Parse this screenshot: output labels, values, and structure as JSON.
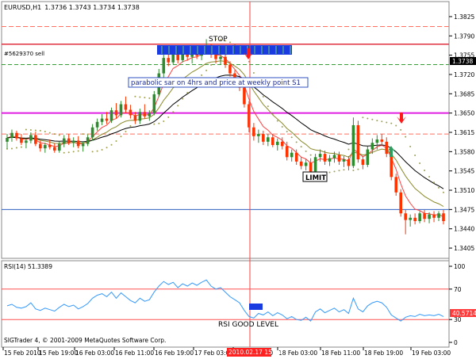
{
  "header": {
    "symbol": "EURUSD,H1",
    "ohlc": "1.3736 1.3743 1.3734 1.3738"
  },
  "price_axis": {
    "ticks": [
      "1.3825",
      "1.3790",
      "1.3755",
      "1.3720",
      "1.3685",
      "1.3650",
      "1.3615",
      "1.3580",
      "1.3545",
      "1.3510",
      "1.3475",
      "1.3440",
      "1.3405"
    ],
    "current_price": "1.3738"
  },
  "annotations": {
    "order_label": "#5629370 sell",
    "stop_label": "STOP",
    "sar_note": "parabolic sar on 4hrs and price at weekly point S1",
    "limit_label": "LIMIT",
    "rsi_good_level": "RSI GOOD LEVEL"
  },
  "rsi": {
    "title": "RSI(14) 51.3389",
    "ticks": [
      "100",
      "70",
      "30",
      "0"
    ],
    "current_value": "40.5714"
  },
  "time_axis": {
    "labels": [
      "15 Feb 2010",
      "15 Feb 19:00",
      "16 Feb 03:00",
      "16 Feb 11:00",
      "16 Feb 19:00",
      "17 Feb 03:00",
      "17 Feb 11:00",
      "18 Feb 03:00",
      "18 Feb 11:00",
      "18 Feb 19:00",
      "19 Feb 03:00"
    ],
    "cursor_label": "2010.02.17 15:00"
  },
  "copyright": "SIGTrader 4, © 2001-2009 MetaQuotes Software Corp.",
  "colors": {
    "bull": "#2e8b2e",
    "bear": "#ff3300",
    "magenta_level": "#e020e0",
    "stop_line": "#e03040",
    "blue_level": "#3060c0",
    "cursor": "#ff4040",
    "rsi_line": "#3399ff",
    "sar_dots": "#a0a050"
  },
  "icons": {
    "sell_arrow": "red-down-arrow-icon",
    "buy_arrow": "green-up-arrow-icon"
  },
  "chart_data": {
    "type": "candlestick",
    "instrument": "EURUSD",
    "timeframe": "H1",
    "ylim": [
      1.3395,
      1.3835
    ],
    "candles": [
      [
        1.3598,
        1.3612,
        1.3585,
        1.3605
      ],
      [
        1.3605,
        1.362,
        1.3598,
        1.3614
      ],
      [
        1.3614,
        1.3618,
        1.36,
        1.3604
      ],
      [
        1.3604,
        1.3612,
        1.3592,
        1.3596
      ],
      [
        1.3596,
        1.3604,
        1.3586,
        1.36
      ],
      [
        1.36,
        1.3615,
        1.3595,
        1.361
      ],
      [
        1.361,
        1.3616,
        1.359,
        1.3594
      ],
      [
        1.3594,
        1.36,
        1.358,
        1.3586
      ],
      [
        1.3586,
        1.3596,
        1.3578,
        1.3592
      ],
      [
        1.3592,
        1.3602,
        1.3584,
        1.3588
      ],
      [
        1.3588,
        1.3595,
        1.3578,
        1.3582
      ],
      [
        1.3582,
        1.3598,
        1.3578,
        1.3594
      ],
      [
        1.3594,
        1.361,
        1.3588,
        1.3604
      ],
      [
        1.3604,
        1.3612,
        1.3592,
        1.3596
      ],
      [
        1.3596,
        1.3606,
        1.3588,
        1.36
      ],
      [
        1.36,
        1.3608,
        1.3586,
        1.359
      ],
      [
        1.359,
        1.3598,
        1.358,
        1.3594
      ],
      [
        1.3594,
        1.361,
        1.359,
        1.3606
      ],
      [
        1.3606,
        1.363,
        1.36,
        1.3624
      ],
      [
        1.3624,
        1.364,
        1.3618,
        1.3634
      ],
      [
        1.3634,
        1.3648,
        1.3628,
        1.364
      ],
      [
        1.364,
        1.3652,
        1.363,
        1.3636
      ],
      [
        1.3636,
        1.366,
        1.3632,
        1.3655
      ],
      [
        1.3655,
        1.3668,
        1.364,
        1.3646
      ],
      [
        1.3646,
        1.3672,
        1.3642,
        1.3666
      ],
      [
        1.3666,
        1.368,
        1.365,
        1.3656
      ],
      [
        1.3656,
        1.3665,
        1.364,
        1.3646
      ],
      [
        1.3646,
        1.3652,
        1.363,
        1.3636
      ],
      [
        1.3636,
        1.3658,
        1.363,
        1.3652
      ],
      [
        1.3652,
        1.3666,
        1.364,
        1.3644
      ],
      [
        1.3644,
        1.3655,
        1.3636,
        1.365
      ],
      [
        1.365,
        1.369,
        1.3646,
        1.3684
      ],
      [
        1.3684,
        1.373,
        1.368,
        1.3722
      ],
      [
        1.3722,
        1.3758,
        1.3712,
        1.375
      ],
      [
        1.375,
        1.3762,
        1.3735,
        1.3742
      ],
      [
        1.3742,
        1.3765,
        1.3738,
        1.376
      ],
      [
        1.376,
        1.3768,
        1.374,
        1.3746
      ],
      [
        1.3746,
        1.3764,
        1.3742,
        1.3758
      ],
      [
        1.3758,
        1.377,
        1.3745,
        1.3752
      ],
      [
        1.3752,
        1.3764,
        1.374,
        1.376
      ],
      [
        1.376,
        1.3772,
        1.3748,
        1.3754
      ],
      [
        1.3754,
        1.377,
        1.3746,
        1.3766
      ],
      [
        1.3766,
        1.3784,
        1.376,
        1.377
      ],
      [
        1.377,
        1.3776,
        1.375,
        1.3756
      ],
      [
        1.3756,
        1.3764,
        1.374,
        1.3748
      ],
      [
        1.3748,
        1.3758,
        1.3738,
        1.3752
      ],
      [
        1.3752,
        1.3758,
        1.3732,
        1.3738
      ],
      [
        1.3738,
        1.3744,
        1.3716,
        1.3722
      ],
      [
        1.3722,
        1.3728,
        1.37,
        1.3708
      ],
      [
        1.3708,
        1.3716,
        1.369,
        1.3696
      ],
      [
        1.3696,
        1.3702,
        1.366,
        1.3666
      ],
      [
        1.3666,
        1.3672,
        1.3615,
        1.3624
      ],
      [
        1.3624,
        1.3632,
        1.36,
        1.3608
      ],
      [
        1.3608,
        1.362,
        1.3596,
        1.3612
      ],
      [
        1.3612,
        1.3618,
        1.3592,
        1.3598
      ],
      [
        1.3598,
        1.3612,
        1.359,
        1.3606
      ],
      [
        1.3606,
        1.3612,
        1.3588,
        1.3592
      ],
      [
        1.3592,
        1.3604,
        1.3582,
        1.3598
      ],
      [
        1.3598,
        1.3606,
        1.3584,
        1.359
      ],
      [
        1.359,
        1.3598,
        1.3564,
        1.357
      ],
      [
        1.357,
        1.3584,
        1.3562,
        1.3578
      ],
      [
        1.3578,
        1.3584,
        1.3556,
        1.3562
      ],
      [
        1.3562,
        1.357,
        1.3548,
        1.3554
      ],
      [
        1.3554,
        1.3566,
        1.3546,
        1.356
      ],
      [
        1.356,
        1.3568,
        1.3538,
        1.3544
      ],
      [
        1.3544,
        1.3576,
        1.354,
        1.357
      ],
      [
        1.357,
        1.3584,
        1.3562,
        1.3576
      ],
      [
        1.3576,
        1.3582,
        1.3556,
        1.3562
      ],
      [
        1.3562,
        1.3574,
        1.3554,
        1.3568
      ],
      [
        1.3568,
        1.358,
        1.356,
        1.3574
      ],
      [
        1.3574,
        1.358,
        1.3556,
        1.3562
      ],
      [
        1.3562,
        1.3572,
        1.3552,
        1.3566
      ],
      [
        1.3566,
        1.3572,
        1.3546,
        1.3554
      ],
      [
        1.3554,
        1.3642,
        1.355,
        1.3628
      ],
      [
        1.3628,
        1.3636,
        1.356,
        1.3566
      ],
      [
        1.3566,
        1.3572,
        1.3548,
        1.3556
      ],
      [
        1.3556,
        1.359,
        1.3552,
        1.3584
      ],
      [
        1.3584,
        1.3604,
        1.3576,
        1.3596
      ],
      [
        1.3596,
        1.361,
        1.3584,
        1.3602
      ],
      [
        1.3602,
        1.3612,
        1.359,
        1.3598
      ],
      [
        1.3598,
        1.3606,
        1.357,
        1.3576
      ],
      [
        1.3576,
        1.3582,
        1.3528,
        1.3534
      ],
      [
        1.3534,
        1.354,
        1.35,
        1.3506
      ],
      [
        1.3506,
        1.3512,
        1.3462,
        1.3468
      ],
      [
        1.3468,
        1.3474,
        1.343,
        1.3456
      ],
      [
        1.3456,
        1.3466,
        1.3444,
        1.346
      ],
      [
        1.346,
        1.3468,
        1.3448,
        1.3454
      ],
      [
        1.3454,
        1.3472,
        1.345,
        1.3468
      ],
      [
        1.3468,
        1.3474,
        1.3452,
        1.3458
      ],
      [
        1.3458,
        1.347,
        1.345,
        1.3466
      ],
      [
        1.3466,
        1.3472,
        1.3452,
        1.346
      ],
      [
        1.346,
        1.3472,
        1.3454,
        1.3468
      ],
      [
        1.3468,
        1.3474,
        1.3448,
        1.3454
      ]
    ],
    "levels": {
      "stop": 1.3775,
      "entry": 1.3738,
      "weekly_s1": 1.365,
      "limit": 1.3475,
      "dashed_upper": 1.3807,
      "dashed_mid": 1.3612
    },
    "rsi_ylim": [
      0,
      100
    ],
    "rsi_levels": [
      70,
      30
    ],
    "rsi_values": [
      48,
      50,
      46,
      45,
      47,
      52,
      44,
      42,
      45,
      43,
      41,
      46,
      50,
      47,
      49,
      44,
      47,
      51,
      58,
      62,
      64,
      60,
      66,
      58,
      65,
      60,
      55,
      52,
      58,
      54,
      56,
      66,
      74,
      80,
      76,
      79,
      72,
      77,
      74,
      78,
      75,
      79,
      82,
      74,
      70,
      72,
      66,
      60,
      56,
      52,
      42,
      34,
      32,
      38,
      36,
      40,
      35,
      39,
      36,
      31,
      34,
      30,
      29,
      33,
      28,
      40,
      44,
      39,
      42,
      45,
      40,
      43,
      38,
      58,
      44,
      40,
      48,
      52,
      54,
      52,
      46,
      36,
      32,
      28,
      33,
      35,
      34,
      37,
      35,
      36,
      35,
      37,
      34
    ]
  }
}
